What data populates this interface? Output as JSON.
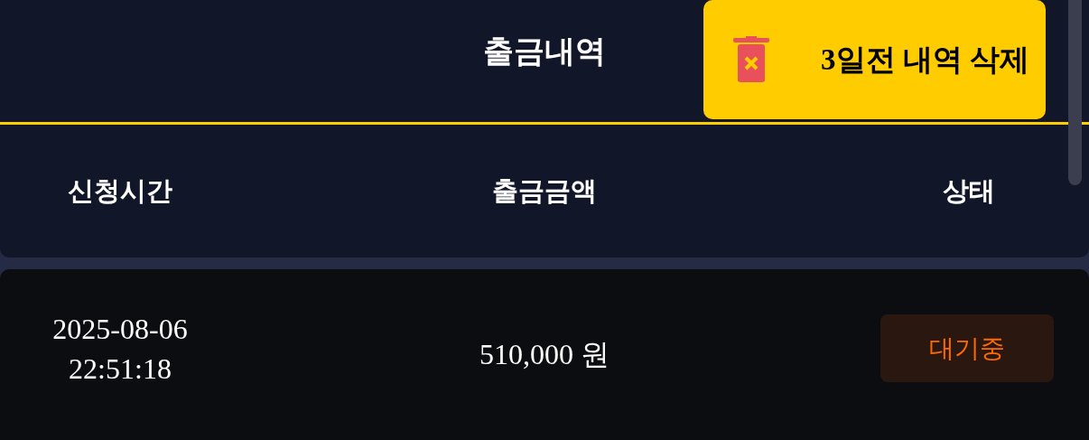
{
  "header": {
    "title": "출금내역",
    "delete_button": "3일전 내역 삭제"
  },
  "table": {
    "columns": [
      "신청시간",
      "출금금액",
      "상태"
    ],
    "rows": [
      {
        "date": "2025-08-06",
        "time": "22:51:18",
        "amount": "510,000 원",
        "status": {
          "label": "대기중",
          "kind": "pending"
        }
      }
    ]
  }
}
